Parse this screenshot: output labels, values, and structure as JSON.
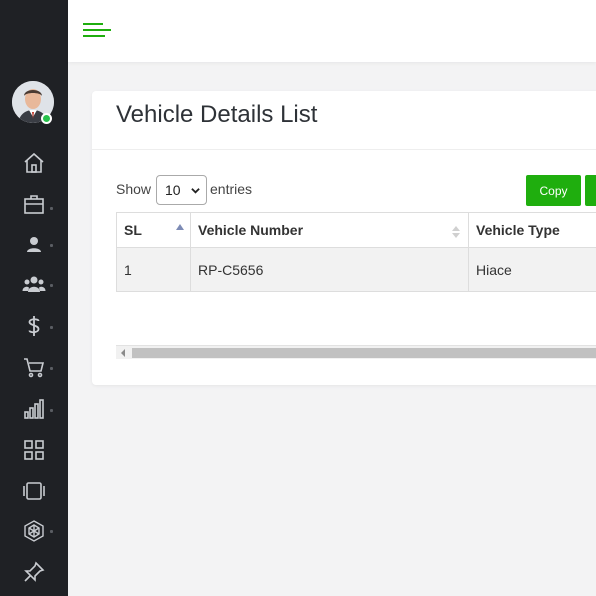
{
  "sidebar": {
    "user": {
      "status": "online"
    },
    "items": [
      {
        "icon": "home-icon"
      },
      {
        "icon": "briefcase-icon"
      },
      {
        "icon": "user-icon"
      },
      {
        "icon": "users-icon"
      },
      {
        "icon": "dollar-icon"
      },
      {
        "icon": "cart-icon"
      },
      {
        "icon": "bar-chart-icon"
      },
      {
        "icon": "grid-icon"
      },
      {
        "icon": "film-icon"
      },
      {
        "icon": "hexagon-icon"
      },
      {
        "icon": "pin-icon"
      }
    ]
  },
  "topbar": {
    "menu_icon": "hamburger-icon"
  },
  "card": {
    "title": "Vehicle Details List",
    "length_menu": {
      "prefix": "Show",
      "value": "10",
      "suffix": "entries"
    },
    "buttons": {
      "copy": "Copy",
      "next": ""
    },
    "table": {
      "columns": [
        "SL",
        "Vehicle Number",
        "Vehicle Type"
      ],
      "rows": [
        {
          "sl": "1",
          "vehicle_number": "RP-C5656",
          "vehicle_type": "Hiace"
        }
      ]
    }
  },
  "colors": {
    "sidebar_bg": "#1f2125",
    "accent_green": "#1fae0e",
    "online_green": "#27c24c",
    "page_bg": "#f3f3f4"
  }
}
